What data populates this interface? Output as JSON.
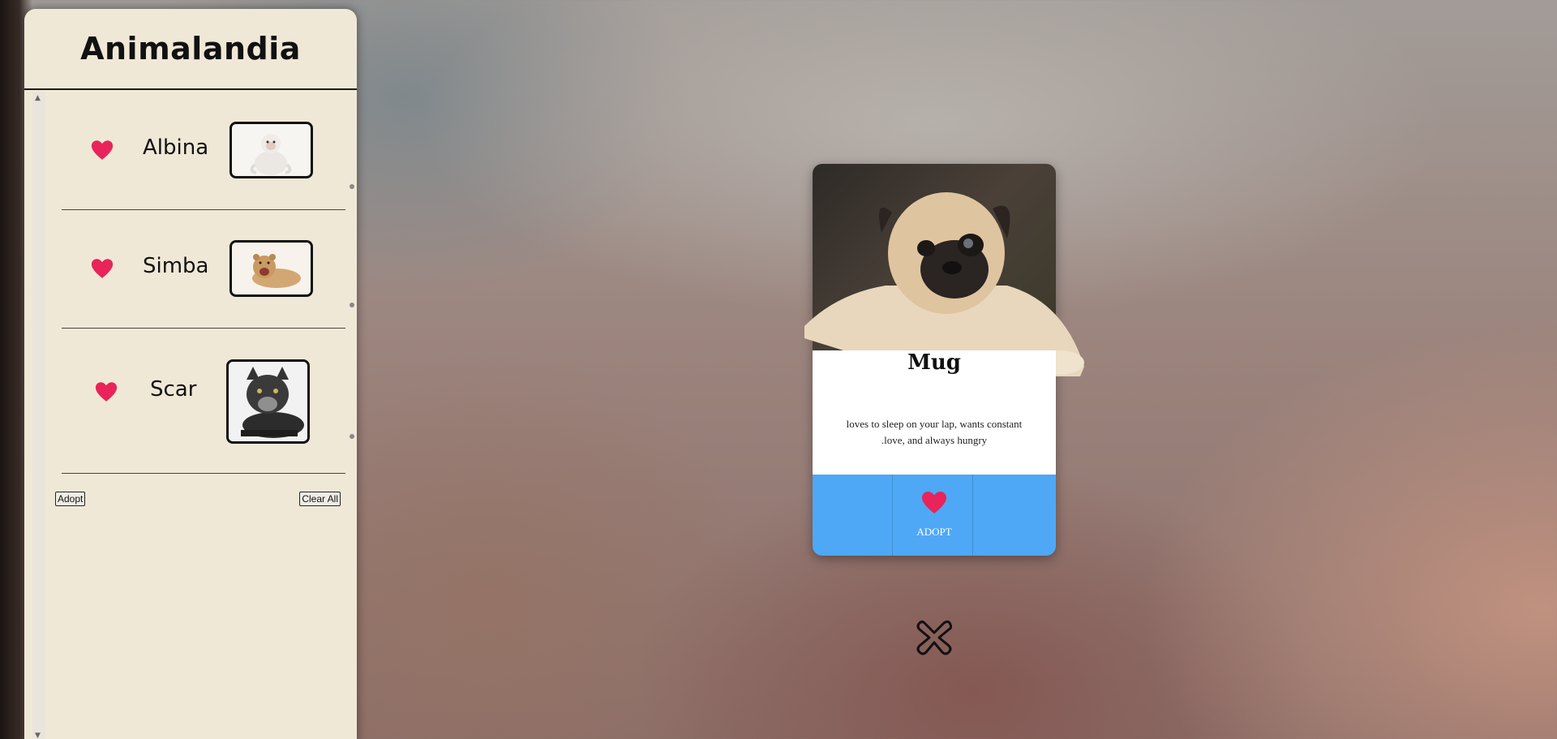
{
  "sidebar": {
    "title": "Animalandia",
    "favorites": [
      {
        "name": "Albina",
        "thumb": "white-monkey"
      },
      {
        "name": "Simba",
        "thumb": "lion-cub"
      },
      {
        "name": "Scar",
        "thumb": "black-cat"
      }
    ],
    "adopt_label": "Adopt",
    "clear_label": "Clear All"
  },
  "card": {
    "name": "Mug",
    "description": "loves to sleep on your lap, wants constant .love, and always hungry",
    "adopt_label": "ADOPT"
  },
  "colors": {
    "sidebar_bg": "#f0e8d6",
    "heart": "#e8245a",
    "card_footer": "#4ea8f6"
  },
  "icons": {
    "favorite": "heart-icon",
    "close": "close-x-icon"
  }
}
